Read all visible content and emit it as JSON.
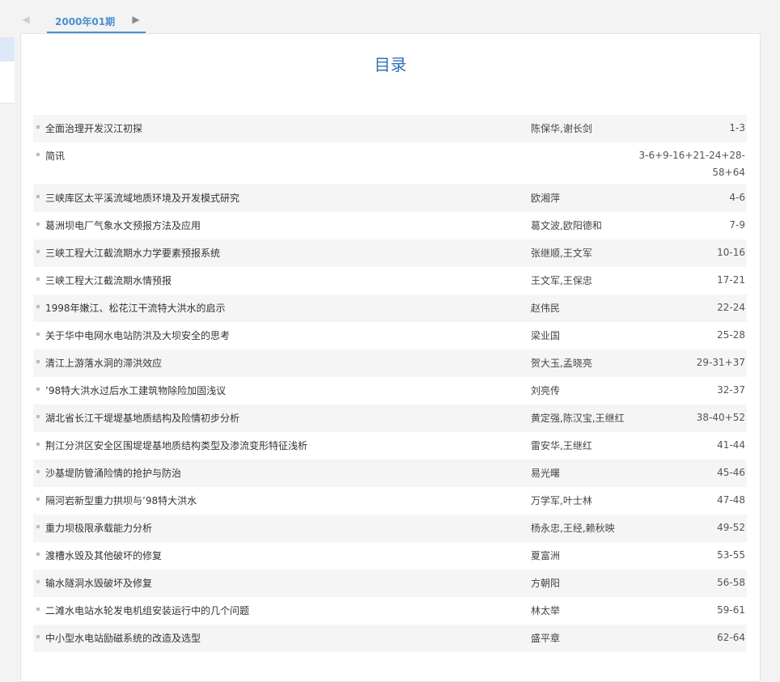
{
  "issue_nav": {
    "prev_icon": "left-triangle",
    "next_icon": "right-triangle",
    "issue_label": "2000年01期"
  },
  "toc": {
    "title": "目录",
    "items": [
      {
        "title": "全面治理开发汉江初探",
        "authors": "陈保华,谢长剑",
        "pages": "1-3"
      },
      {
        "title": "简讯",
        "authors": "",
        "pages": "3-6+9-16+21-24+28-58+64"
      },
      {
        "title": "三峡库区太平溪流域地质环境及开发模式研究",
        "authors": "欧湘萍",
        "pages": "4-6"
      },
      {
        "title": "葛洲坝电厂气象水文预报方法及应用",
        "authors": "葛文波,欧阳德和",
        "pages": "7-9"
      },
      {
        "title": "三峡工程大江截流期水力学要素预报系统",
        "authors": "张继顺,王文军",
        "pages": "10-16"
      },
      {
        "title": "三峡工程大江截流期水情预报",
        "authors": "王文军,王保忠",
        "pages": "17-21"
      },
      {
        "title": "1998年嫩江、松花江干流特大洪水的启示",
        "authors": "赵伟民",
        "pages": "22-24"
      },
      {
        "title": "关于华中电网水电站防洪及大坝安全的思考",
        "authors": "梁业国",
        "pages": "25-28"
      },
      {
        "title": "清江上游落水洞的滞洪效应",
        "authors": "贺大玉,孟晓亮",
        "pages": "29-31+37"
      },
      {
        "title": "’98特大洪水过后水工建筑物除险加固浅议",
        "authors": "刘亮传",
        "pages": "32-37"
      },
      {
        "title": "湖北省长江干堤堤基地质结构及险情初步分析",
        "authors": "黄定强,陈汉宝,王继红",
        "pages": "38-40+52"
      },
      {
        "title": "荆江分洪区安全区围堤堤基地质结构类型及渗流变形特征浅析",
        "authors": "雷安华,王继红",
        "pages": "41-44"
      },
      {
        "title": "沙基堤防管涌险情的抢护与防治",
        "authors": "易光曙",
        "pages": "45-46"
      },
      {
        "title": "隔河岩新型重力拱坝与’98特大洪水",
        "authors": "万学军,叶士林",
        "pages": "47-48"
      },
      {
        "title": "重力坝极限承载能力分析",
        "authors": "杨永忠,王经,赖秋映",
        "pages": "49-52"
      },
      {
        "title": "渡槽水毁及其他破坏的修复",
        "authors": "夏富洲",
        "pages": "53-55"
      },
      {
        "title": "输水隧洞水毁破坏及修复",
        "authors": "方朝阳",
        "pages": "56-58"
      },
      {
        "title": "二滩水电站水轮发电机组安装运行中的几个问题",
        "authors": "林太举",
        "pages": "59-61"
      },
      {
        "title": "中小型水电站励磁系统的改造及选型",
        "authors": "盛平章",
        "pages": "62-64"
      }
    ]
  }
}
